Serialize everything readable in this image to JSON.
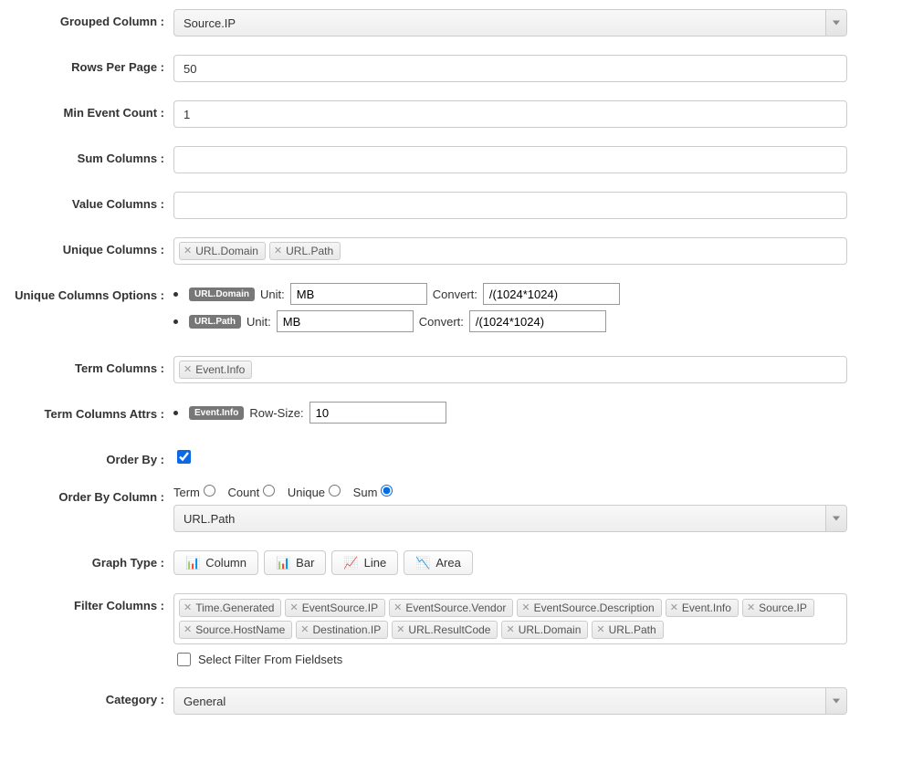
{
  "labels": {
    "grouped_column": "Grouped Column :",
    "rows_per_page": "Rows Per Page :",
    "min_event_count": "Min Event Count :",
    "sum_columns": "Sum Columns :",
    "value_columns": "Value Columns :",
    "unique_columns": "Unique Columns :",
    "unique_columns_options": "Unique Columns Options :",
    "term_columns": "Term Columns :",
    "term_columns_attrs": "Term Columns Attrs :",
    "order_by": "Order By :",
    "order_by_column": "Order By Column :",
    "graph_type": "Graph Type :",
    "filter_columns": "Filter Columns :",
    "category": "Category :"
  },
  "grouped_column": {
    "value": "Source.IP"
  },
  "rows_per_page": {
    "value": "50"
  },
  "min_event_count": {
    "value": "1"
  },
  "sum_columns": {
    "value": ""
  },
  "value_columns": {
    "value": ""
  },
  "unique_columns": {
    "tags": [
      "URL.Domain",
      "URL.Path"
    ]
  },
  "unique_columns_options": {
    "unit_label": "Unit:",
    "convert_label": "Convert:",
    "rows": [
      {
        "name": "URL.Domain",
        "unit": "MB",
        "convert": "/(1024*1024)"
      },
      {
        "name": "URL.Path",
        "unit": "MB",
        "convert": "/(1024*1024)"
      }
    ]
  },
  "term_columns": {
    "tags": [
      "Event.Info"
    ]
  },
  "term_columns_attrs": {
    "row_size_label": "Row-Size:",
    "rows": [
      {
        "name": "Event.Info",
        "row_size": "10"
      }
    ]
  },
  "order_by": {
    "checked": true
  },
  "order_by_column": {
    "radios": {
      "term": "Term",
      "count": "Count",
      "unique": "Unique",
      "sum": "Sum"
    },
    "selected": "sum",
    "value": "URL.Path"
  },
  "graph_type": {
    "options": [
      {
        "key": "column",
        "label": "Column"
      },
      {
        "key": "bar",
        "label": "Bar"
      },
      {
        "key": "line",
        "label": "Line"
      },
      {
        "key": "area",
        "label": "Area"
      }
    ]
  },
  "filter_columns": {
    "tags": [
      "Time.Generated",
      "EventSource.IP",
      "EventSource.Vendor",
      "EventSource.Description",
      "Event.Info",
      "Source.IP",
      "Source.HostName",
      "Destination.IP",
      "URL.ResultCode",
      "URL.Domain",
      "URL.Path"
    ],
    "select_from_fieldsets_label": "Select Filter From Fieldsets",
    "select_from_fieldsets_checked": false
  },
  "category": {
    "value": "General"
  }
}
